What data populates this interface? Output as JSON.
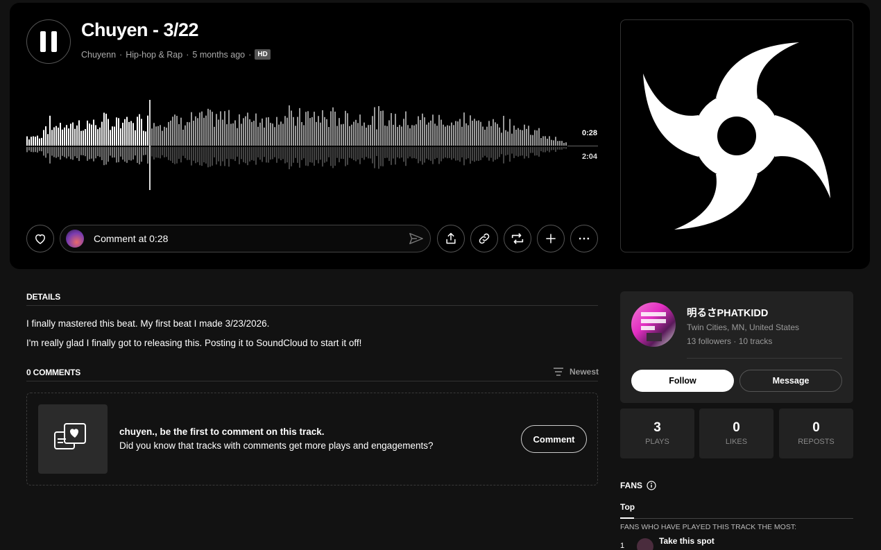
{
  "track": {
    "title": "Chuyen - 3/22",
    "artist": "Chuyenn",
    "genre": "Hip-hop & Rap",
    "age": "5 months ago",
    "quality_badge": "HD",
    "current_time": "0:28",
    "duration": "2:04",
    "progress": 0.226
  },
  "comment_box": {
    "placeholder": "Comment at 0:28"
  },
  "details": {
    "heading": "DETAILS",
    "lines": [
      "I finally mastered this beat. My first beat I made 3/23/2026.",
      "I'm really glad I finally got to releasing this. Posting it to SoundCloud to start it off!"
    ]
  },
  "comments": {
    "heading": "0 COMMENTS",
    "sort_label": "Newest",
    "empty_title": "chuyen., be the first to comment on this track.",
    "empty_sub": "Did you know that tracks with comments get more plays and engagements?",
    "button": "Comment"
  },
  "artist_card": {
    "name": "明るさPHATKIDD",
    "location": "Twin Cities, MN, United States",
    "stats": "13 followers · 10 tracks",
    "follow": "Follow",
    "message": "Message"
  },
  "stats": [
    {
      "value": "3",
      "label": "PLAYS"
    },
    {
      "value": "0",
      "label": "LIKES"
    },
    {
      "value": "0",
      "label": "REPOSTS"
    }
  ],
  "fans": {
    "heading": "FANS",
    "tab": "Top",
    "subheading": "FANS WHO HAVE PLAYED THIS TRACK THE MOST:",
    "rows": [
      {
        "rank": "1",
        "label": "Take this spot"
      }
    ]
  },
  "icons": {
    "play": "pause-icon",
    "like": "heart-icon",
    "send": "send-icon",
    "share": "share-icon",
    "link": "link-icon",
    "repost": "repost-icon",
    "add": "plus-icon",
    "more": "more-icon",
    "sort": "sort-icon",
    "info": "info-icon"
  },
  "colors": {
    "background": "#121212",
    "hero": "#000000",
    "card": "#222222",
    "wave_played": "#ffffff",
    "wave_unplayed": "#8a8a8a"
  }
}
